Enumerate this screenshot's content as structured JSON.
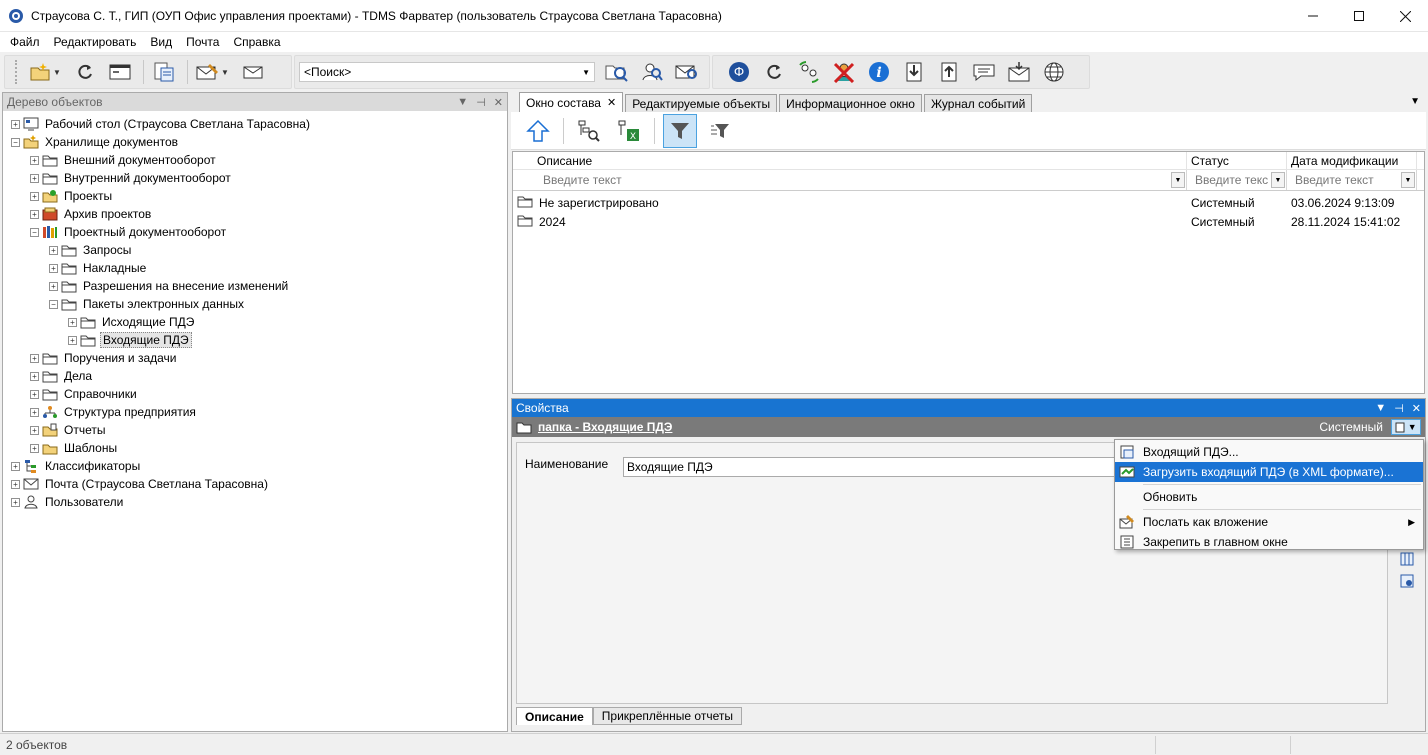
{
  "window": {
    "title": "Страусова С. Т., ГИП (ОУП Офис управления проектами) - TDMS Фарватер (пользователь Страусова Светлана Тарасовна)"
  },
  "menu": [
    "Файл",
    "Редактировать",
    "Вид",
    "Почта",
    "Справка"
  ],
  "toolbar": {
    "search_value": "<Поиск>"
  },
  "left_panel": {
    "title": "Дерево объектов",
    "tree": [
      {
        "label": "Рабочий стол (Страусова Светлана Тарасовна)",
        "icon": "desktop-icon",
        "level": 0,
        "expander": "+"
      },
      {
        "label": "Хранилище документов",
        "icon": "storage-icon",
        "level": 0,
        "expander": "-"
      },
      {
        "label": "Внешний документооборот",
        "icon": "folder-icon",
        "level": 1,
        "expander": "+"
      },
      {
        "label": "Внутренний документооборот",
        "icon": "folder-icon",
        "level": 1,
        "expander": "+"
      },
      {
        "label": "Проекты",
        "icon": "projects-icon",
        "level": 1,
        "expander": "+"
      },
      {
        "label": "Архив проектов",
        "icon": "archive-icon",
        "level": 1,
        "expander": "+"
      },
      {
        "label": "Проектный документооборот",
        "icon": "books-icon",
        "level": 1,
        "expander": "-"
      },
      {
        "label": "Запросы",
        "icon": "folder-icon",
        "level": 2,
        "expander": "+"
      },
      {
        "label": "Накладные",
        "icon": "folder-icon",
        "level": 2,
        "expander": "+"
      },
      {
        "label": "Разрешения на внесение изменений",
        "icon": "folder-icon",
        "level": 2,
        "expander": "+"
      },
      {
        "label": "Пакеты электронных данных",
        "icon": "folder-icon",
        "level": 2,
        "expander": "-"
      },
      {
        "label": "Исходящие ПДЭ",
        "icon": "folder-icon",
        "level": 3,
        "expander": "+"
      },
      {
        "label": "Входящие ПДЭ",
        "icon": "folder-icon",
        "level": 3,
        "expander": "+",
        "selected": true
      },
      {
        "label": "Поручения и задачи",
        "icon": "folder-icon",
        "level": 1,
        "expander": "+"
      },
      {
        "label": "Дела",
        "icon": "folder-icon",
        "level": 1,
        "expander": "+"
      },
      {
        "label": "Справочники",
        "icon": "folder-icon",
        "level": 1,
        "expander": "+"
      },
      {
        "label": "Структура предприятия",
        "icon": "org-structure-icon",
        "level": 1,
        "expander": "+"
      },
      {
        "label": "Отчеты",
        "icon": "reports-icon",
        "level": 1,
        "expander": "+"
      },
      {
        "label": "Шаблоны",
        "icon": "templates-icon",
        "level": 1,
        "expander": "+"
      },
      {
        "label": "Классификаторы",
        "icon": "classifier-icon",
        "level": 0,
        "expander": "+"
      },
      {
        "label": "Почта (Страусова Светлана Тарасовна)",
        "icon": "mail-icon",
        "level": 0,
        "expander": "+"
      },
      {
        "label": "Пользователи",
        "icon": "user-icon",
        "level": 0,
        "expander": "+"
      }
    ]
  },
  "tabs": [
    {
      "label": "Окно состава",
      "active": true
    },
    {
      "label": "Редактируемые объекты"
    },
    {
      "label": "Информационное окно"
    },
    {
      "label": "Журнал событий"
    }
  ],
  "grid": {
    "columns": [
      "Описание",
      "Статус",
      "Дата модификации"
    ],
    "filter_placeholders": [
      "Введите текст",
      "Введите текс",
      "Введите текст"
    ],
    "rows": [
      {
        "description": "Не зарегистрировано",
        "status": "Системный",
        "date": "03.06.2024 9:13:09"
      },
      {
        "description": "2024",
        "status": "Системный",
        "date": "28.11.2024 15:41:02"
      }
    ]
  },
  "properties": {
    "title": "Свойства",
    "object_link": "папка - Входящие ПДЭ",
    "status": "Системный",
    "field_label": "Наименование",
    "field_value": "Входящие ПДЭ",
    "tabs": [
      "Описание",
      "Прикреплённые отчеты"
    ]
  },
  "context_menu": [
    {
      "label": "Входящий ПДЭ...",
      "icon": "incoming-package-icon"
    },
    {
      "label": "Загрузить входящий ПДЭ (в XML формате)...",
      "icon": "xml-import-icon",
      "highlight": true
    },
    {
      "separator": true
    },
    {
      "label": "Обновить"
    },
    {
      "separator": true
    },
    {
      "label": "Послать как вложение",
      "icon": "send-attachment-icon",
      "submenu": true
    },
    {
      "label": "Закрепить в главном окне",
      "icon": "pin-window-icon"
    }
  ],
  "statusbar": {
    "text": "2 объектов"
  },
  "colors": {
    "selection_blue": "#1a73d4",
    "panel_active": "#1874d1",
    "props_subhead": "#7a7a7a"
  }
}
